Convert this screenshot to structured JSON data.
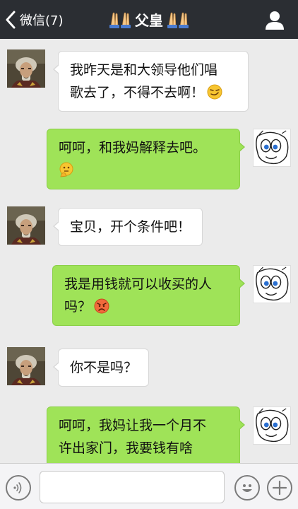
{
  "header": {
    "back_label": "微信(7)",
    "title": "父皇",
    "title_decoration_icon": "praying-hands-icon",
    "right_icon": "user-profile-icon"
  },
  "messages": [
    {
      "side": "in",
      "avatar": "contact-avatar",
      "line1": "我昨天是和大领导他们唱",
      "line2": "歌去了，不得不去啊！",
      "emoji": "smirk-emoji"
    },
    {
      "side": "out",
      "avatar": "self-avatar",
      "line1": "呵呵，和我妈解释去吧。",
      "emoji": "thinking-emoji"
    },
    {
      "side": "in",
      "avatar": "contact-avatar",
      "line1": "宝贝，开个条件吧！"
    },
    {
      "side": "out",
      "avatar": "self-avatar",
      "line1": "我是用钱就可以收买的人",
      "line2": "吗？",
      "emoji": "angry-emoji"
    },
    {
      "side": "in",
      "avatar": "contact-avatar",
      "line1": "你不是吗？"
    },
    {
      "side": "out",
      "avatar": "self-avatar",
      "line1": "呵呵，我妈让我一个月不",
      "line2": "许出家门，我要钱有啥"
    }
  ],
  "input_bar": {
    "voice_icon": "voice-icon",
    "emoji_icon": "emoji-icon",
    "plus_icon": "plus-icon",
    "input_value": ""
  },
  "colors": {
    "header_bg": "#2b2e33",
    "chat_bg": "#ebebeb",
    "incoming_bubble": "#ffffff",
    "outgoing_bubble": "#9fe358"
  }
}
